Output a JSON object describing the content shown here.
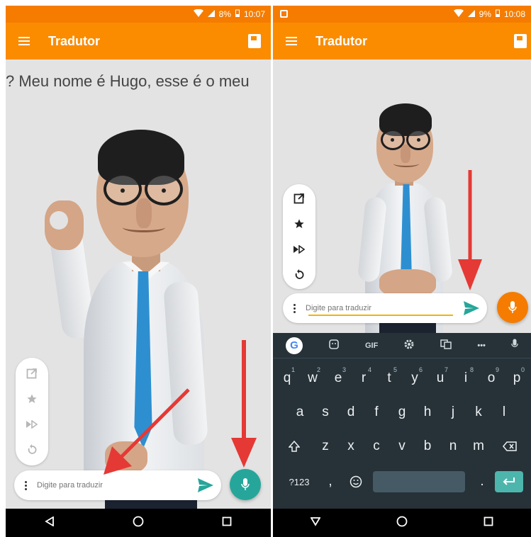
{
  "left_screen": {
    "status": {
      "battery": "8%",
      "time": "10:07"
    },
    "toolbar": {
      "title": "Tradutor"
    },
    "subtitle": "? Meu nome é Hugo, esse é o meu",
    "input": {
      "placeholder": "Digite para traduzir"
    },
    "side_actions": [
      "external-link-icon",
      "star-icon",
      "playback-speed-icon",
      "replay-icon"
    ],
    "mic_color": "#26a69a"
  },
  "right_screen": {
    "status": {
      "battery": "9%",
      "time": "10:08"
    },
    "toolbar": {
      "title": "Tradutor"
    },
    "input": {
      "placeholder": "Digite para traduzir"
    },
    "side_actions": [
      "external-link-icon",
      "star-icon",
      "playback-speed-icon",
      "replay-icon"
    ],
    "mic_color": "#f57c00",
    "keyboard": {
      "toolbar": {
        "google": "G",
        "gif": "GIF",
        "more": "•••"
      },
      "row1": [
        {
          "k": "q",
          "n": "1"
        },
        {
          "k": "w",
          "n": "2"
        },
        {
          "k": "e",
          "n": "3"
        },
        {
          "k": "r",
          "n": "4"
        },
        {
          "k": "t",
          "n": "5"
        },
        {
          "k": "y",
          "n": "6"
        },
        {
          "k": "u",
          "n": "7"
        },
        {
          "k": "i",
          "n": "8"
        },
        {
          "k": "o",
          "n": "9"
        },
        {
          "k": "p",
          "n": "0"
        }
      ],
      "row2": [
        "a",
        "s",
        "d",
        "f",
        "g",
        "h",
        "j",
        "k",
        "l"
      ],
      "row3": [
        "z",
        "x",
        "c",
        "v",
        "b",
        "n",
        "m"
      ],
      "symbols": "?123",
      "comma": ",",
      "period": "."
    }
  },
  "colors": {
    "toolbar": "#fb8c00",
    "statusbar": "#f57c00",
    "send": "#26a69a",
    "arrow": "#e53935",
    "keyboard_bg": "#263238"
  }
}
